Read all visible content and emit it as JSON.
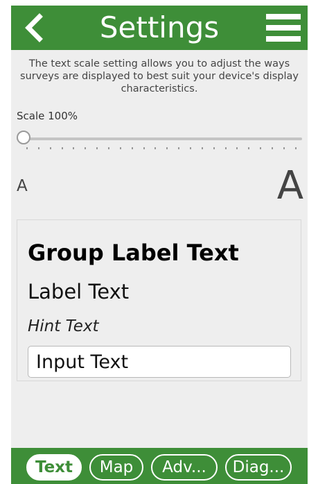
{
  "header": {
    "title": "Settings",
    "back_icon": "chevron-left-icon",
    "menu_icon": "hamburger-menu-icon"
  },
  "description": "The text scale setting allows you to adjust the ways surveys are displayed to best suit your device's display characteristics.",
  "scale": {
    "label": "Scale 100%",
    "value_percent": 100,
    "slider_position": 0,
    "small_glyph": "A",
    "large_glyph": "A"
  },
  "preview": {
    "group_label": "Group Label Text",
    "label": "Label Text",
    "hint": "Hint Text",
    "input_value": "Input Text"
  },
  "tabs": [
    {
      "label": "Text",
      "active": true
    },
    {
      "label": "Map",
      "active": false
    },
    {
      "label": "Adv...",
      "active": false
    },
    {
      "label": "Diag...",
      "active": false
    }
  ],
  "colors": {
    "brand_green": "#3e8e38",
    "background": "#eeeeee",
    "text_primary": "#000000"
  }
}
